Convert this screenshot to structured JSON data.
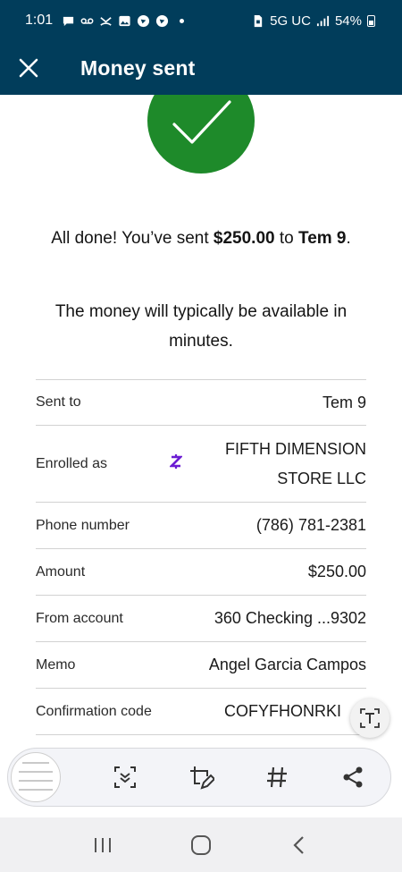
{
  "status_bar": {
    "time": "1:01",
    "network": "5G UC",
    "battery": "54%",
    "icons": [
      "chat-bubble-icon",
      "voicemail-icon",
      "missed-call-icon",
      "gallery-icon",
      "circle-app-icon",
      "circle-app-icon",
      "notification-dot-icon",
      "sim-lock-icon",
      "signal-bars-icon",
      "battery-icon"
    ]
  },
  "header": {
    "title": "Money sent",
    "close_icon": "close-icon",
    "background": "#013d5b"
  },
  "success": {
    "icon": "checkmark-icon",
    "color": "#1e8a2a",
    "line1_prefix": "All done! You’ve sent ",
    "amount": "$250.00",
    "line1_mid": " to ",
    "recipient": "Tem 9",
    "line1_suffix": ".",
    "availability": "The money will typically be available in minutes."
  },
  "details": {
    "sent_to": {
      "label": "Sent to",
      "value": "Tem 9"
    },
    "enrolled_as": {
      "label": "Enrolled as",
      "value_line1": "FIFTH DIMENSION",
      "value_line2": "STORE LLC",
      "badge_icon": "zelle-z-icon",
      "badge_color": "#6c1cd3"
    },
    "phone": {
      "label": "Phone number",
      "value": "(786) 781-2381"
    },
    "amount": {
      "label": "Amount",
      "value": "$250.00"
    },
    "from_account": {
      "label": "From account",
      "value": "360 Checking ...9302"
    },
    "memo": {
      "label": "Memo",
      "value": "Angel Garcia Campos"
    },
    "confirmation": {
      "label": "Confirmation code",
      "value": "COFYFHONRKI"
    }
  },
  "screenshot_toolbar": {
    "items": [
      "screenshot-thumbnail",
      "scroll-capture-icon",
      "draw-edit-icon",
      "hashtag-icon",
      "share-icon"
    ],
    "text_extract_icon": "text-extract-icon"
  },
  "nav_bar": {
    "items": [
      "recent-apps-icon",
      "home-icon",
      "back-icon"
    ]
  }
}
